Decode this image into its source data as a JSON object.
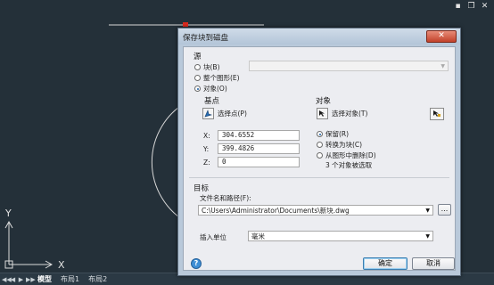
{
  "window_controls": {
    "minimize": "▪",
    "restore": "❐",
    "close": "✕"
  },
  "axes": {
    "x": "X",
    "y": "Y"
  },
  "layout_tabs": {
    "nav": [
      "◀◀",
      "◀",
      "▶",
      "▶▶"
    ],
    "items": [
      {
        "label": "模型",
        "active": true
      },
      {
        "label": "布局1",
        "active": false
      },
      {
        "label": "布局2",
        "active": false
      }
    ]
  },
  "dialog": {
    "title": "保存块到磁盘",
    "close": "✕",
    "source": {
      "title": "源",
      "options": [
        {
          "label": "块(B)",
          "checked": false
        },
        {
          "label": "整个图形(E)",
          "checked": false
        },
        {
          "label": "对象(O)",
          "checked": true
        }
      ],
      "block_combo_value": ""
    },
    "base_point": {
      "title": "基点",
      "pick_label": "选择点(P)",
      "x_label": "X:",
      "x_value": "304.6552",
      "y_label": "Y:",
      "y_value": "399.4826",
      "z_label": "Z:",
      "z_value": "0"
    },
    "objects": {
      "title": "对象",
      "select_label": "选择对象(T)",
      "options": [
        {
          "label": "保留(R)",
          "checked": true
        },
        {
          "label": "转换为块(C)",
          "checked": false
        },
        {
          "label": "从图形中删除(D)",
          "checked": false
        }
      ],
      "status": "3 个对象被选取"
    },
    "target": {
      "title": "目标",
      "file_label": "文件名和路径(F):",
      "file_value": "C:\\Users\\Administrator\\Documents\\新块.dwg",
      "browse": "...",
      "units_label": "插入单位",
      "units_value": "毫米"
    },
    "buttons": {
      "help": "?",
      "ok": "确定",
      "cancel": "取消"
    }
  },
  "colors": {
    "canvas_bg": "#243039",
    "dialog_frame": "#b9c9da",
    "close_red": "#c2412a",
    "accent_blue": "#1b5fa8"
  }
}
